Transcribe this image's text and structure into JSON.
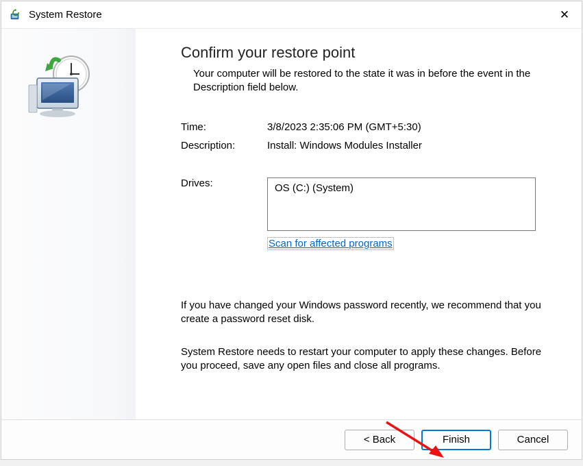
{
  "window": {
    "title": "System Restore"
  },
  "heading": "Confirm your restore point",
  "intro": "Your computer will be restored to the state it was in before the event in the Description field below.",
  "fields": {
    "time_label": "Time:",
    "time_value": "3/8/2023 2:35:06 PM (GMT+5:30)",
    "description_label": "Description:",
    "description_value": "Install: Windows Modules Installer",
    "drives_label": "Drives:",
    "drives_value": "OS (C:) (System)",
    "scan_link": "Scan for affected programs"
  },
  "note_password": "If you have changed your Windows password recently, we recommend that you create a password reset disk.",
  "note_restart": "System Restore needs to restart your computer to apply these changes. Before you proceed, save any open files and close all programs.",
  "buttons": {
    "back": "< Back",
    "finish": "Finish",
    "cancel": "Cancel"
  }
}
